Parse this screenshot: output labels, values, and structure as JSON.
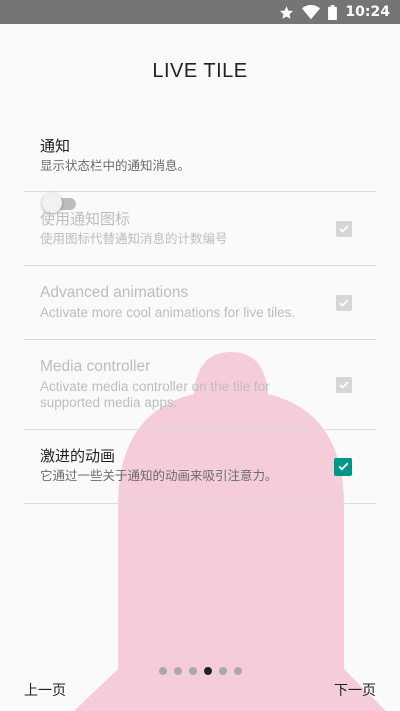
{
  "status_bar": {
    "time": "10:24",
    "icons": [
      "star-icon",
      "wifi-icon",
      "battery-icon"
    ]
  },
  "page": {
    "title": "LIVE TILE"
  },
  "settings": [
    {
      "title": "通知",
      "subtitle": "显示状态栏中的通知消息。",
      "control": "switch",
      "checked": false,
      "enabled": true
    },
    {
      "title": "使用通知图标",
      "subtitle": "使用图标代替通知消息的计数编号",
      "control": "checkbox",
      "checked": true,
      "enabled": false
    },
    {
      "title": "Advanced animations",
      "subtitle": "Activate more cool animations for live tiles.",
      "control": "checkbox",
      "checked": true,
      "enabled": false
    },
    {
      "title": "Media controller",
      "subtitle": "Activate media controller on the tile for supported media apps.",
      "control": "checkbox",
      "checked": true,
      "enabled": false
    },
    {
      "title": "激进的动画",
      "subtitle": "它通过一些关于通知的动画来吸引注意力。",
      "control": "checkbox",
      "checked": true,
      "enabled": true
    }
  ],
  "pager": {
    "prev_label": "上一页",
    "next_label": "下一页",
    "page_count": 6,
    "current_page": 4
  },
  "colors": {
    "accent": "#009688",
    "bell": "#f5cdda",
    "status_bar": "#757575"
  },
  "background_icon": "bell-icon"
}
